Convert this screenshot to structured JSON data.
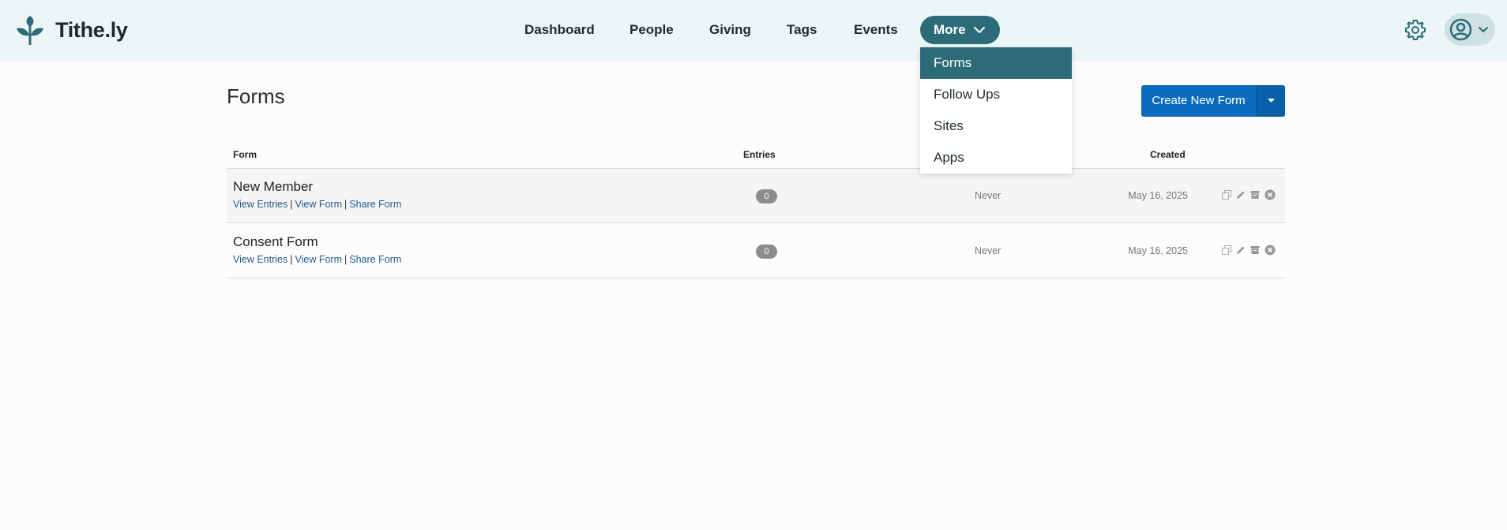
{
  "app": {
    "name": "Tithe.ly"
  },
  "nav": {
    "items": [
      {
        "label": "Dashboard"
      },
      {
        "label": "People"
      },
      {
        "label": "Giving"
      },
      {
        "label": "Tags"
      },
      {
        "label": "Events"
      }
    ],
    "more_label": "More"
  },
  "more_menu": {
    "items": [
      {
        "label": "Forms",
        "active": true
      },
      {
        "label": "Follow Ups"
      },
      {
        "label": "Sites"
      },
      {
        "label": "Apps"
      }
    ]
  },
  "page": {
    "title": "Forms",
    "create_button_label": "Create New Form"
  },
  "table": {
    "headers": {
      "form": "Form",
      "entries": "Entries",
      "created": "Created"
    },
    "link_labels": {
      "view_entries": "View Entries",
      "view_form": "View Form",
      "share_form": "Share Form",
      "separator": "|"
    },
    "rows": [
      {
        "name": "New Member",
        "entries": "0",
        "last_entry": "Never",
        "created": "May 16, 2025"
      },
      {
        "name": "Consent Form",
        "entries": "0",
        "last_entry": "Never",
        "created": "May 16, 2025"
      }
    ]
  },
  "icons": {
    "logo": "sprout-logo-icon",
    "settings": "gear-icon",
    "user": "user-avatar-icon",
    "chevron": "chevron-down-icon",
    "caret": "caret-down-icon",
    "copy": "copy-icon",
    "edit": "pencil-icon",
    "archive": "archive-icon",
    "delete": "close-circle-icon"
  },
  "colors": {
    "header_bg": "#edf6f7",
    "accent_teal": "#2c6b78",
    "primary_blue": "#0a6bbd",
    "link_blue": "#1e5a8e"
  }
}
